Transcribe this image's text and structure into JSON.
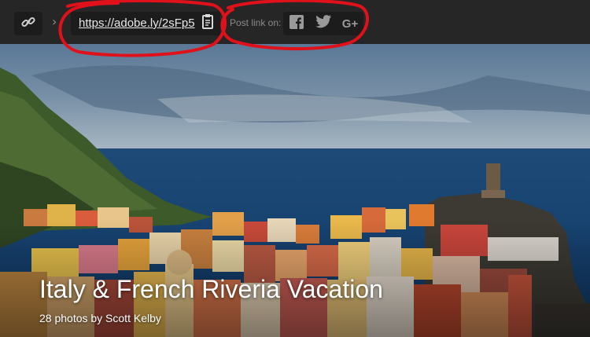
{
  "toolbar": {
    "link_icon": "link-icon",
    "share_url": "https://adobe.ly/2sFp5",
    "copy_icon": "clipboard-icon",
    "post_label": "Post link on:",
    "social": [
      "facebook-icon",
      "twitter-icon",
      "google-plus-icon"
    ],
    "gplus_text": "G+"
  },
  "album": {
    "title": "Italy & French Riveria Vacation",
    "subtitle": "28 photos by Scott Kelby"
  },
  "colors": {
    "toolbar_bg": "#262626",
    "annotation": "#e0111a"
  }
}
